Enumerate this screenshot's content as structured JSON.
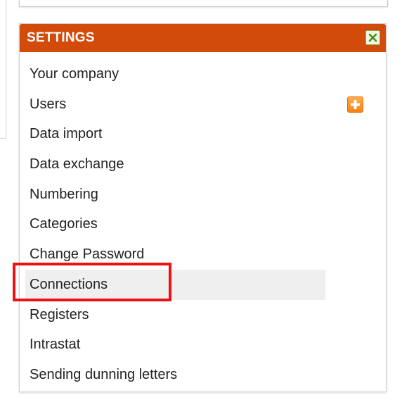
{
  "settings": {
    "title": "SETTINGS",
    "close_icon": "close-icon",
    "add_user_icon": "plus-icon",
    "items": [
      {
        "label": "Your company"
      },
      {
        "label": "Users"
      },
      {
        "label": "Data import"
      },
      {
        "label": "Data exchange"
      },
      {
        "label": "Numbering"
      },
      {
        "label": "Categories"
      },
      {
        "label": "Change Password"
      },
      {
        "label": "Connections"
      },
      {
        "label": "Registers"
      },
      {
        "label": "Intrastat"
      },
      {
        "label": "Sending dunning letters"
      }
    ]
  },
  "colors": {
    "header": "#d34b0b",
    "highlight": "#ef1111",
    "add_button": "#f58216",
    "close_button_border": "#7ea84e"
  }
}
